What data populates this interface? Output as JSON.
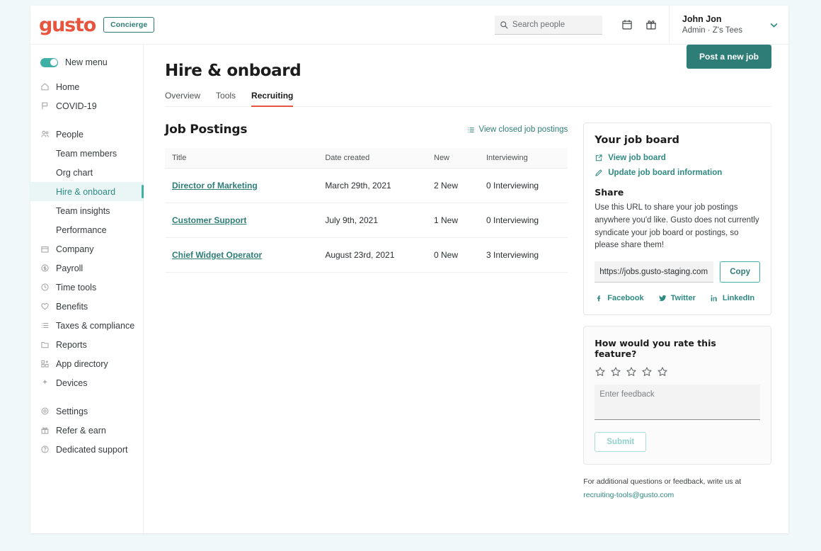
{
  "topbar": {
    "logo_text": "gusto",
    "concierge_label": "Concierge",
    "search": {
      "placeholder": "Search people",
      "value": ""
    },
    "calendar_icon": "calendar-icon",
    "gift_icon": "gift-icon",
    "user_name": "John Jon",
    "user_sub": "Admin · Z's Tees"
  },
  "sidebar": {
    "toggle_label": "New menu",
    "toggle_on": true,
    "items": [
      {
        "label": "Home",
        "icon": "home-icon",
        "type": "top"
      },
      {
        "label": "COVID-19",
        "icon": "flag-icon",
        "type": "top"
      },
      {
        "label": "People",
        "icon": "people-icon",
        "type": "top"
      },
      {
        "label": "Team members",
        "type": "sub"
      },
      {
        "label": "Org chart",
        "type": "sub"
      },
      {
        "label": "Hire & onboard",
        "type": "sub",
        "active": true
      },
      {
        "label": "Team insights",
        "type": "sub"
      },
      {
        "label": "Performance",
        "type": "sub"
      },
      {
        "label": "Company",
        "icon": "building-icon",
        "type": "top"
      },
      {
        "label": "Payroll",
        "icon": "dollar-icon",
        "type": "top"
      },
      {
        "label": "Time tools",
        "icon": "clock-icon",
        "type": "top"
      },
      {
        "label": "Benefits",
        "icon": "heart-icon",
        "type": "top"
      },
      {
        "label": "Taxes & compliance",
        "icon": "list-icon",
        "type": "top"
      },
      {
        "label": "Reports",
        "icon": "folder-icon",
        "type": "top"
      },
      {
        "label": "App directory",
        "icon": "grid-icon",
        "type": "top"
      },
      {
        "label": "Devices",
        "icon": "spark-icon",
        "type": "top"
      },
      {
        "label": "Settings",
        "icon": "gear-icon",
        "type": "top"
      },
      {
        "label": "Refer & earn",
        "icon": "gift-icon",
        "type": "top"
      },
      {
        "label": "Dedicated support",
        "icon": "help-icon",
        "type": "top"
      }
    ]
  },
  "main": {
    "page_title": "Hire & onboard",
    "tabs": [
      {
        "label": "Overview",
        "active": false
      },
      {
        "label": "Tools",
        "active": false
      },
      {
        "label": "Recruiting",
        "active": true
      }
    ],
    "section_title": "Job Postings",
    "closed_link": "View closed job postings",
    "post_button": "Post a new job",
    "table": {
      "columns": [
        "Title",
        "Date created",
        "New",
        "Interviewing"
      ],
      "rows": [
        {
          "title": "Director of Marketing",
          "date": "March 29th, 2021",
          "new": "2 New",
          "interviewing": "0 Interviewing"
        },
        {
          "title": "Customer Support",
          "date": "July 9th, 2021",
          "new": "1 New",
          "interviewing": "0 Interviewing"
        },
        {
          "title": "Chief Widget Operator",
          "date": "August 23rd, 2021",
          "new": "0 New",
          "interviewing": "3 Interviewing"
        }
      ]
    }
  },
  "job_board": {
    "title": "Your job board",
    "view_link": "View job board",
    "update_link": "Update job board information",
    "share_title": "Share",
    "share_text": "Use this URL to share your job postings anywhere you'd like. Gusto does not currently syndicate your job board or postings, so please share them!",
    "url_value": "https://jobs.gusto-staging.com",
    "copy_label": "Copy",
    "socials": [
      {
        "label": "Facebook",
        "icon": "facebook-icon"
      },
      {
        "label": "Twitter",
        "icon": "twitter-icon"
      },
      {
        "label": "LinkedIn",
        "icon": "linkedin-icon"
      }
    ]
  },
  "feedback": {
    "question": "How would you rate this feature?",
    "stars_total": 5,
    "stars_selected": 0,
    "placeholder": "Enter feedback",
    "value": "",
    "submit_label": "Submit",
    "footer_prefix": "For additional questions or feedback, write us at ",
    "footer_link": "recruiting-tools@gusto.com"
  },
  "colors": {
    "brand_orange": "#e8553e",
    "teal": "#2e7d77",
    "teal_light": "#3fb0a5",
    "page_bg": "#f1f8f9"
  }
}
